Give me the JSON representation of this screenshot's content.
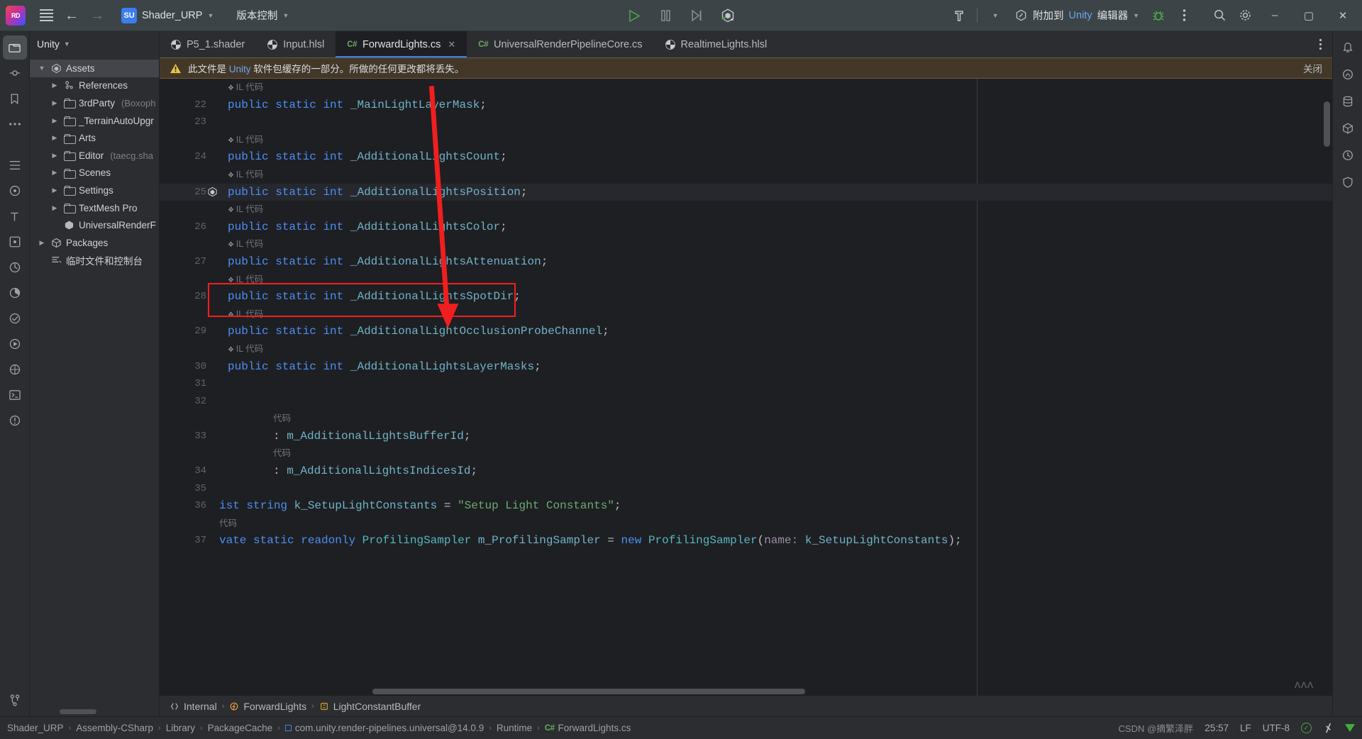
{
  "titlebar": {
    "logo": "rider-logo",
    "menu_icon": "hamburger-menu-icon",
    "back_icon": "back-arrow-icon",
    "forward_icon": "forward-arrow-icon",
    "project_badge": "SU",
    "project_name": "Shader_URP",
    "vcs_label": "版本控制",
    "run_icon": "run-play-icon",
    "pause_icon": "pause-icon",
    "step_icon": "step-over-icon",
    "unity_icon": "unity-logo-icon",
    "build_icon": "hammer-build-icon",
    "attach_label": "附加到 Unity 编辑器",
    "debug_icon": "debug-bug-icon",
    "more_icon": "more-vertical-icon",
    "search_icon": "search-icon",
    "settings_icon": "gear-icon",
    "minimize": "–",
    "maximize": "▢",
    "close": "✕"
  },
  "toolwindow": {
    "title": "Unity",
    "tree": [
      {
        "indent": 0,
        "arrow": "open",
        "icon": "unity-asset-icon",
        "label": "Assets",
        "sub": "",
        "selected": true
      },
      {
        "indent": 1,
        "arrow": "closed",
        "icon": "references-icon",
        "label": "References",
        "sub": "",
        "selected": false
      },
      {
        "indent": 1,
        "arrow": "closed",
        "icon": "folder-icon",
        "label": "3rdParty",
        "sub": "(Boxoph",
        "selected": false
      },
      {
        "indent": 1,
        "arrow": "closed",
        "icon": "folder-icon",
        "label": "_TerrainAutoUpgr",
        "sub": "",
        "selected": false
      },
      {
        "indent": 1,
        "arrow": "closed",
        "icon": "folder-icon",
        "label": "Arts",
        "sub": "",
        "selected": false
      },
      {
        "indent": 1,
        "arrow": "closed",
        "icon": "folder-edit-icon",
        "label": "Editor",
        "sub": "(taecg.sha",
        "selected": false
      },
      {
        "indent": 1,
        "arrow": "closed",
        "icon": "folder-icon",
        "label": "Scenes",
        "sub": "",
        "selected": false
      },
      {
        "indent": 1,
        "arrow": "closed",
        "icon": "folder-icon",
        "label": "Settings",
        "sub": "",
        "selected": false
      },
      {
        "indent": 1,
        "arrow": "closed",
        "icon": "folder-icon",
        "label": "TextMesh Pro",
        "sub": "",
        "selected": false
      },
      {
        "indent": 1,
        "arrow": "none",
        "icon": "package-icon",
        "label": "UniversalRenderF",
        "sub": "",
        "selected": false
      },
      {
        "indent": 0,
        "arrow": "closed",
        "icon": "packages-icon",
        "label": "Packages",
        "sub": "",
        "selected": false
      },
      {
        "indent": 0,
        "arrow": "none",
        "icon": "scratches-icon",
        "label": "临时文件和控制台",
        "sub": "",
        "selected": false
      }
    ]
  },
  "tabs": [
    {
      "label": "P5_1.shader",
      "icon": "shader-file-icon",
      "active": false,
      "closable": false
    },
    {
      "label": "Input.hlsl",
      "icon": "shader-file-icon",
      "active": false,
      "closable": false
    },
    {
      "label": "ForwardLights.cs",
      "icon": "csharp-file-icon",
      "active": true,
      "closable": true
    },
    {
      "label": "UniversalRenderPipelineCore.cs",
      "icon": "csharp-file-icon",
      "active": false,
      "closable": false
    },
    {
      "label": "RealtimeLights.hlsl",
      "icon": "shader-file-icon",
      "active": false,
      "closable": false
    }
  ],
  "tabs_more_icon": "tab-options-icon",
  "banner": {
    "warning_icon": "warning-triangle-icon",
    "text_pre": "此文件是 ",
    "text_blue": "Unity",
    "text_post": " 软件包缓存的一部分。所做的任何更改都将丢失。",
    "close_label": "关闭"
  },
  "editor": {
    "hint_text": "IL 代码",
    "hint_text_short": "代码",
    "lines": [
      {
        "no": "",
        "hint": true,
        "hintText": "IL 代码"
      },
      {
        "no": "22",
        "tokens": [
          {
            "t": "public",
            "c": "kw"
          },
          {
            "t": " ",
            "c": "pun"
          },
          {
            "t": "static",
            "c": "kw"
          },
          {
            "t": " ",
            "c": "pun"
          },
          {
            "t": "int",
            "c": "kw"
          },
          {
            "t": " ",
            "c": "pun"
          },
          {
            "t": "_MainLightLayerMask",
            "c": "id"
          },
          {
            "t": ";",
            "c": "pun"
          }
        ]
      },
      {
        "no": "23",
        "tokens": []
      },
      {
        "no": "",
        "hint": true,
        "hintText": "IL 代码"
      },
      {
        "no": "24",
        "tokens": [
          {
            "t": "public",
            "c": "kw"
          },
          {
            "t": " ",
            "c": "pun"
          },
          {
            "t": "static",
            "c": "kw"
          },
          {
            "t": " ",
            "c": "pun"
          },
          {
            "t": "int",
            "c": "kw"
          },
          {
            "t": " ",
            "c": "pun"
          },
          {
            "t": "_AdditionalLightsCount",
            "c": "id"
          },
          {
            "t": ";",
            "c": "pun"
          }
        ]
      },
      {
        "no": "",
        "hint": true,
        "hintText": "IL 代码"
      },
      {
        "no": "25",
        "bulb": true,
        "hl": true,
        "tokens": [
          {
            "t": "public",
            "c": "kw"
          },
          {
            "t": " ",
            "c": "pun"
          },
          {
            "t": "static",
            "c": "kw"
          },
          {
            "t": " ",
            "c": "pun"
          },
          {
            "t": "int",
            "c": "kw"
          },
          {
            "t": " ",
            "c": "pun"
          },
          {
            "t": "_AdditionalLightsPosition",
            "c": "id"
          },
          {
            "t": ";",
            "c": "pun"
          }
        ]
      },
      {
        "no": "",
        "hint": true,
        "hintText": "IL 代码"
      },
      {
        "no": "26",
        "tokens": [
          {
            "t": "public",
            "c": "kw"
          },
          {
            "t": " ",
            "c": "pun"
          },
          {
            "t": "static",
            "c": "kw"
          },
          {
            "t": " ",
            "c": "pun"
          },
          {
            "t": "int",
            "c": "kw"
          },
          {
            "t": " ",
            "c": "pun"
          },
          {
            "t": "_AdditionalLightsColor",
            "c": "id"
          },
          {
            "t": ";",
            "c": "pun"
          }
        ]
      },
      {
        "no": "",
        "hint": true,
        "hintText": "IL 代码"
      },
      {
        "no": "27",
        "tokens": [
          {
            "t": "public",
            "c": "kw"
          },
          {
            "t": " ",
            "c": "pun"
          },
          {
            "t": "static",
            "c": "kw"
          },
          {
            "t": " ",
            "c": "pun"
          },
          {
            "t": "int",
            "c": "kw"
          },
          {
            "t": " ",
            "c": "pun"
          },
          {
            "t": "_AdditionalLightsAttenuation",
            "c": "id"
          },
          {
            "t": ";",
            "c": "pun"
          }
        ]
      },
      {
        "no": "",
        "hint": true,
        "hintText": "IL 代码"
      },
      {
        "no": "28",
        "tokens": [
          {
            "t": "public",
            "c": "kw"
          },
          {
            "t": " ",
            "c": "pun"
          },
          {
            "t": "static",
            "c": "kw"
          },
          {
            "t": " ",
            "c": "pun"
          },
          {
            "t": "int",
            "c": "kw"
          },
          {
            "t": " ",
            "c": "pun"
          },
          {
            "t": "_AdditionalLightsSpotDir",
            "c": "id"
          },
          {
            "t": ";",
            "c": "pun"
          }
        ]
      },
      {
        "no": "",
        "hint": true,
        "hintText": "IL 代码"
      },
      {
        "no": "29",
        "tokens": [
          {
            "t": "public",
            "c": "kw"
          },
          {
            "t": " ",
            "c": "pun"
          },
          {
            "t": "static",
            "c": "kw"
          },
          {
            "t": " ",
            "c": "pun"
          },
          {
            "t": "int",
            "c": "kw"
          },
          {
            "t": " ",
            "c": "pun"
          },
          {
            "t": "_AdditionalLightOcclusionProbeChannel",
            "c": "id"
          },
          {
            "t": ";",
            "c": "pun"
          }
        ]
      },
      {
        "no": "",
        "hint": true,
        "hintText": "IL 代码"
      },
      {
        "no": "30",
        "tokens": [
          {
            "t": "public",
            "c": "kw"
          },
          {
            "t": " ",
            "c": "pun"
          },
          {
            "t": "static",
            "c": "kw"
          },
          {
            "t": " ",
            "c": "pun"
          },
          {
            "t": "int",
            "c": "kw"
          },
          {
            "t": " ",
            "c": "pun"
          },
          {
            "t": "_AdditionalLightsLayerMasks",
            "c": "id"
          },
          {
            "t": ";",
            "c": "pun"
          }
        ]
      },
      {
        "no": "31",
        "tokens": []
      },
      {
        "no": "32",
        "tokens": []
      },
      {
        "no": "",
        "hint": true,
        "hintText": "代码",
        "shifted": true
      },
      {
        "no": "33",
        "shifted": true,
        "tokens": [
          {
            "t": ": ",
            "c": "pun"
          },
          {
            "t": "m_AdditionalLightsBufferId",
            "c": "id"
          },
          {
            "t": ";",
            "c": "pun"
          }
        ]
      },
      {
        "no": "",
        "hint": true,
        "hintText": "代码",
        "shifted": true
      },
      {
        "no": "34",
        "shifted": true,
        "tokens": [
          {
            "t": ": ",
            "c": "pun"
          },
          {
            "t": "m_AdditionalLightsIndicesId",
            "c": "id"
          },
          {
            "t": ";",
            "c": "pun"
          }
        ]
      },
      {
        "no": "35",
        "tokens": []
      },
      {
        "no": "36",
        "shifted2": true,
        "tokens": [
          {
            "t": "ist ",
            "c": "kw"
          },
          {
            "t": "string",
            "c": "kw"
          },
          {
            "t": " ",
            "c": "pun"
          },
          {
            "t": "k_SetupLightConstants",
            "c": "id"
          },
          {
            "t": " = ",
            "c": "pun"
          },
          {
            "t": "\"Setup Light Constants\"",
            "c": "str"
          },
          {
            "t": ";",
            "c": "pun"
          }
        ]
      },
      {
        "no": "",
        "hint": true,
        "hintText": "代码",
        "shifted2": true
      },
      {
        "no": "37",
        "shifted2": true,
        "tokens": [
          {
            "t": "vate ",
            "c": "kw"
          },
          {
            "t": "static",
            "c": "kw"
          },
          {
            "t": " ",
            "c": "pun"
          },
          {
            "t": "readonly",
            "c": "kw"
          },
          {
            "t": " ",
            "c": "pun"
          },
          {
            "t": "ProfilingSampler",
            "c": "ty"
          },
          {
            "t": " ",
            "c": "pun"
          },
          {
            "t": "m_ProfilingSampler",
            "c": "id"
          },
          {
            "t": " = ",
            "c": "pun"
          },
          {
            "t": "new",
            "c": "kw"
          },
          {
            "t": " ",
            "c": "pun"
          },
          {
            "t": "ProfilingSampler",
            "c": "ty"
          },
          {
            "t": "(",
            "c": "pun"
          },
          {
            "t": "name:",
            "c": "prm"
          },
          {
            "t": " ",
            "c": "pun"
          },
          {
            "t": "k_SetupLightConstants",
            "c": "id"
          },
          {
            "t": ");",
            "c": "pun"
          }
        ]
      }
    ],
    "minimap_marks": "ΛΛΛ"
  },
  "breadcrumbs": [
    {
      "icon": "internal-scope-icon",
      "label": "Internal"
    },
    {
      "icon": "class-icon",
      "label": "ForwardLights"
    },
    {
      "icon": "struct-icon",
      "label": "LightConstantBuffer"
    }
  ],
  "rightrail": [
    {
      "icon": "notifications-bell-icon"
    },
    {
      "icon": "ai-assistant-icon"
    },
    {
      "icon": "database-icon"
    },
    {
      "icon": "unity-package-icon"
    },
    {
      "icon": "history-icon"
    },
    {
      "icon": "shield-icon"
    }
  ],
  "leftrail": [
    {
      "icon": "project-folder-icon",
      "active": true
    },
    {
      "icon": "commit-icon",
      "active": false
    },
    {
      "icon": "bookmarks-icon",
      "active": false
    },
    {
      "icon": "more-tools-icon",
      "active": false
    },
    {
      "icon": "todo-list-icon",
      "active": false
    },
    {
      "icon": "unity-explorer-icon",
      "active": false
    },
    {
      "icon": "typography-icon",
      "active": false
    },
    {
      "icon": "structure-icon",
      "active": false
    },
    {
      "icon": "endpoints-icon",
      "active": false
    },
    {
      "icon": "profiler-pie-icon",
      "active": false
    },
    {
      "icon": "coverage-icon",
      "active": false
    },
    {
      "icon": "run-tool-icon",
      "active": false
    },
    {
      "icon": "services-icon",
      "active": false
    },
    {
      "icon": "terminal-icon",
      "active": false
    },
    {
      "icon": "problems-icon",
      "active": false
    },
    {
      "icon": "version-control-icon",
      "active": false
    }
  ],
  "statusbar": {
    "path": [
      "Shader_URP",
      "Assembly-CSharp",
      "Library",
      "PackageCache",
      "com.unity.render-pipelines.universal@14.0.9",
      "Runtime",
      "ForwardLights.cs"
    ],
    "file_icon": "csharp-file-icon",
    "package_icon": "package-blue-icon",
    "caret": "25:57",
    "line_sep": "LF",
    "encoding": "UTF-8",
    "inspection_icon": "inspections-ok-icon",
    "branch_icon": "branch-icon",
    "down_icon": "download-green-icon",
    "watermark": "CSDN @摘繁泽胖"
  },
  "colors": {
    "accent": "#3b7cf0",
    "warn_bg": "#433828",
    "red_annotation": "#f01f1f",
    "green_run": "#4f9e4f"
  }
}
